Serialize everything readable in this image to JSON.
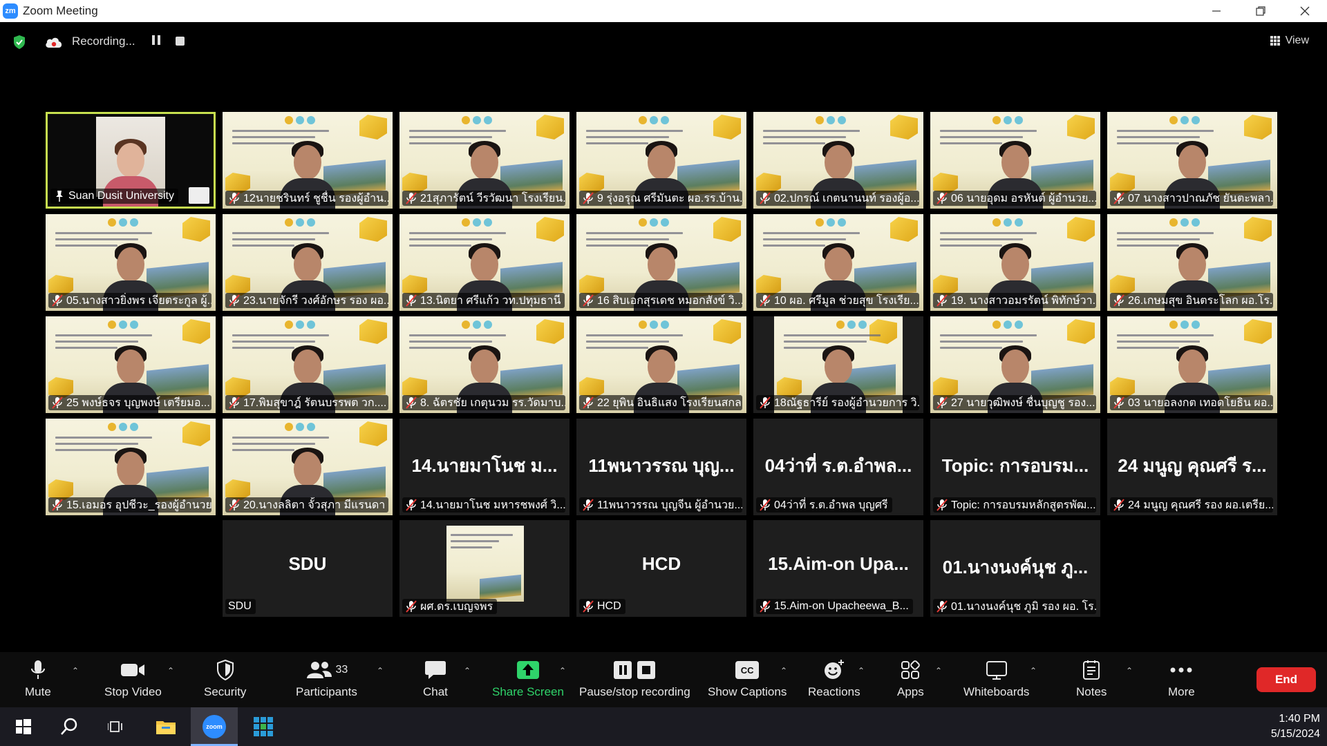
{
  "window": {
    "logo": "zm",
    "title": "Zoom Meeting",
    "controls": [
      "minimize-icon",
      "restore-icon",
      "close-icon"
    ]
  },
  "topbar": {
    "recording_label": "Recording...",
    "view_label": "View",
    "colors": {
      "shield": "#2fb84f"
    }
  },
  "tiles": [
    {
      "name": "Suan Dusit University",
      "type": "video-pinned",
      "muted": false
    },
    {
      "name": "12นายชรินทร์ ชูชื่น รองผู้อำน...",
      "type": "slide",
      "muted": true
    },
    {
      "name": "21สุภารัตน์ วีรวัฒนา โรงเรียน...",
      "type": "slide",
      "muted": true
    },
    {
      "name": "9 รุ่งอรุณ ศรีมันตะ ผอ.รร.บ้าน...",
      "type": "slide",
      "muted": true
    },
    {
      "name": "02.ปกรณ์ เกตนานนท์ รองผู้อ...",
      "type": "slide",
      "muted": true
    },
    {
      "name": "06 นายอุดม อรหันต์ ผู้อำนวย...",
      "type": "slide",
      "muted": true
    },
    {
      "name": "07 นางสาวปาณภัช ยันตะพลา...",
      "type": "slide",
      "muted": true
    },
    {
      "name": "05.นางสาวยิ่งพร เจียตระกูล ผู้...",
      "type": "slide",
      "muted": true
    },
    {
      "name": "23.นายจักรี วงศ์อักษร รอง ผอ....",
      "type": "slide",
      "muted": true
    },
    {
      "name": "13.นิตยา ศรีแก้ว วท.ปทุมธานี",
      "type": "slide",
      "muted": true
    },
    {
      "name": "16 สิบเอกสุรเดช หมอกสังข์ วิ...",
      "type": "slide",
      "muted": true
    },
    {
      "name": "10 ผอ. ศรีมูล ช่วยสุข โรงเรีย...",
      "type": "slide",
      "muted": true
    },
    {
      "name": "19. นางสาวอมรรัตน์ พิทักษ์วา...",
      "type": "slide",
      "muted": true
    },
    {
      "name": "26.เกษมสุข อินตระโลก ผอ.โร...",
      "type": "slide",
      "muted": true
    },
    {
      "name": "25 พงษ์ธจร บุญพงษ์ เตรียมอ...",
      "type": "slide",
      "muted": true
    },
    {
      "name": "17.พิมสุขาฎ์ รัตนบรรพต วก....",
      "type": "slide",
      "muted": true
    },
    {
      "name": "8. ฉัตรชัย เกตุนวม รร.วัดมาบ...",
      "type": "slide",
      "muted": true
    },
    {
      "name": "22 ยุพิน อินธิแสง โรงเรียนสกล...",
      "type": "slide",
      "muted": true
    },
    {
      "name": "18ณัฐธารีย์ รองผู้อำนวยการ วิ...",
      "type": "slide-narrow",
      "muted": true
    },
    {
      "name": "27 นายวุฒิพงษ์ ชื่นบุญชู รอง...",
      "type": "slide",
      "muted": true
    },
    {
      "name": "03 นายอลงกต เทอดโยธิน ผอ....",
      "type": "slide",
      "muted": true
    },
    {
      "name": "15.เอมอร อุปชีวะ_รองผู้อำนวย...",
      "type": "slide",
      "muted": true
    },
    {
      "name": "20.นางลลิตา จั้วสุภา มีแรนดา ...",
      "type": "slide",
      "muted": true
    },
    {
      "name": "14.นายมาโนช มหารชพงศ์ วิ...",
      "big": "14.นายมาโนช ม...",
      "type": "novideo",
      "muted": true
    },
    {
      "name": "11พนาวรรณ บุญจีน ผู้อำนวย...",
      "big": "11พนาวรรณ บุญ...",
      "type": "novideo",
      "muted": true
    },
    {
      "name": "04ว่าที่ ร.ต.อำพล บุญศรี",
      "big": "04ว่าที่ ร.ต.อำพล...",
      "type": "novideo",
      "muted": true
    },
    {
      "name": "Topic: การอบรมหลักสูตรพัฒ...",
      "big": "Topic: การอบรม...",
      "type": "novideo",
      "muted": true
    },
    {
      "name": "24 มนูญ คุณศรี รอง ผอ.เตรีย...",
      "big": "24 มนูญ คุณศรี ร...",
      "type": "novideo",
      "muted": true
    },
    {
      "name": "SDU",
      "big": "SDU",
      "type": "novideo",
      "muted": false
    },
    {
      "name": "ผศ.ดร.เบญจพร",
      "type": "thumb",
      "muted": true
    },
    {
      "name": "HCD",
      "big": "HCD",
      "type": "novideo",
      "muted": true
    },
    {
      "name": "15.Aim-on Upacheewa_B...",
      "big": "15.Aim-on Upa...",
      "type": "novideo",
      "muted": true
    },
    {
      "name": "01.นางนงค์นุช ภูมิ รอง ผอ. โร...",
      "big": "01.นางนงค์นุช ภู...",
      "type": "novideo",
      "muted": true
    }
  ],
  "toolbar": {
    "mute": "Mute",
    "stop_video": "Stop Video",
    "security": "Security",
    "participants": "Participants",
    "participants_count": "33",
    "chat": "Chat",
    "share_screen": "Share Screen",
    "pause_recording": "Pause/stop recording",
    "captions": "Show Captions",
    "captions_badge": "CC",
    "reactions": "Reactions",
    "apps": "Apps",
    "whiteboards": "Whiteboards",
    "notes": "Notes",
    "more": "More",
    "end": "End",
    "colors": {
      "share": "#2fd36a",
      "end": "#e02828",
      "active_border": "#c7e04f"
    }
  },
  "taskbar": {
    "time": "1:40 PM",
    "date": "5/15/2024",
    "zoom_label": "zoom",
    "icons": [
      "windows-start-icon",
      "search-icon",
      "task-view-icon",
      "file-explorer-icon",
      "zoom-app-icon",
      "store-app-icon"
    ]
  }
}
